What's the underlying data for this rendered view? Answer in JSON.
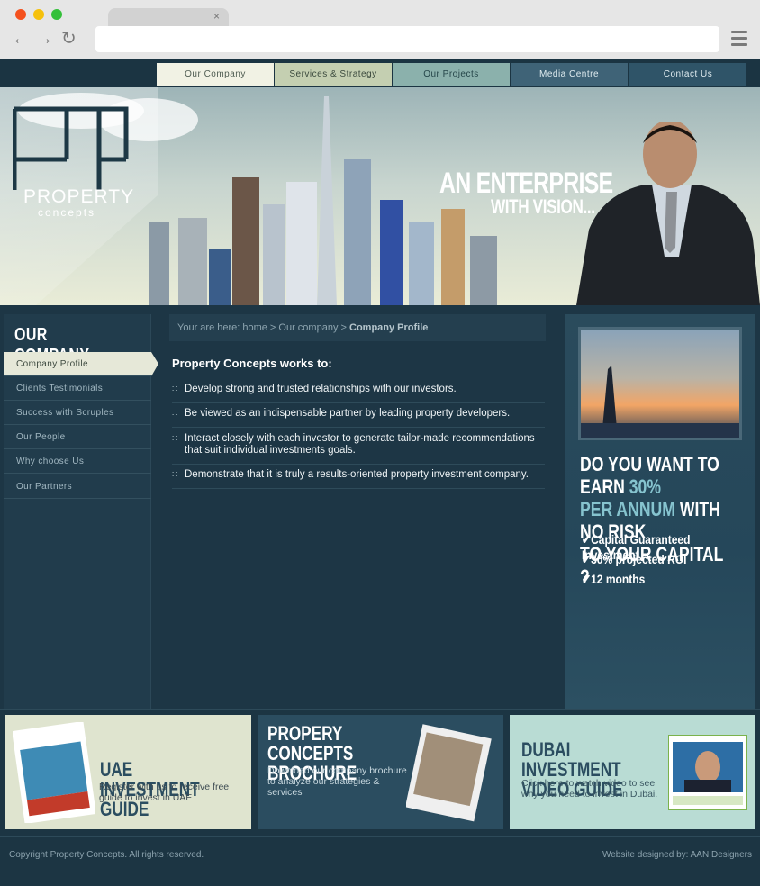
{
  "browser": {
    "tab_close": "×",
    "back_icon": "←",
    "forward_icon": "→",
    "reload_icon": "↻"
  },
  "nav": [
    {
      "label": "Our Company"
    },
    {
      "label": "Services & Strategy"
    },
    {
      "label": "Our Projects"
    },
    {
      "label": "Media Centre"
    },
    {
      "label": "Contact Us"
    }
  ],
  "banner": {
    "logo_main": "PROPERTY",
    "logo_sub": "concepts",
    "tagline_line1": "AN ENTERPRISE",
    "tagline_line2": "WITH VISION..."
  },
  "sidebar": {
    "title": "OUR COMPANY",
    "items": [
      {
        "label": "Company Profile"
      },
      {
        "label": "Clients Testimonials"
      },
      {
        "label": "Success with Scruples"
      },
      {
        "label": "Our People"
      },
      {
        "label": "Why choose Us"
      },
      {
        "label": "Our Partners"
      }
    ]
  },
  "breadcrumb": {
    "prefix": "Your are here: home > Our company >",
    "current": "Company Profile"
  },
  "content": {
    "intro": "Property Concepts works to:",
    "bullets": [
      "Develop strong and trusted relationships with our investors.",
      "Be viewed as an indispensable partner by leading property developers.",
      "Interact closely with each investor to generate tailor-made recommendations that suit individual investments goals.",
      "Demonstrate that it is truly a results-oriented property investment company."
    ]
  },
  "promo": {
    "line1a": "DO YOU WANT TO EARN ",
    "line1b": "30%",
    "line2a": "PER ANNUM",
    "line2b": " WITH NO RISK",
    "line3": "TO YOUR CAPITAL ?",
    "points": [
      "Capital Guaranteed Investment",
      "30% projected ROI",
      "12 months"
    ]
  },
  "boxes": [
    {
      "title": "UAE INVESTMENT GUIDE",
      "text": "Register with us to receive free guide to invest in UAE"
    },
    {
      "title": "PROPERY CONCEPTS BROCHURE",
      "text": "Download our company brochure to analyze our strategies & services"
    },
    {
      "title": "DUBAI INVESTMENT VIDEO GUIDE",
      "text": "Click here to watch video to see why you need to invest in Dubai."
    }
  ],
  "footer": {
    "copyright": "Copyright Property Concepts. All rights reserved.",
    "credit": "Website designed by: AAN Designers"
  },
  "colors": {
    "page_bg": "#1c3543",
    "accent_teal": "#86c4cf",
    "nav_active": "#f1f2e4"
  }
}
